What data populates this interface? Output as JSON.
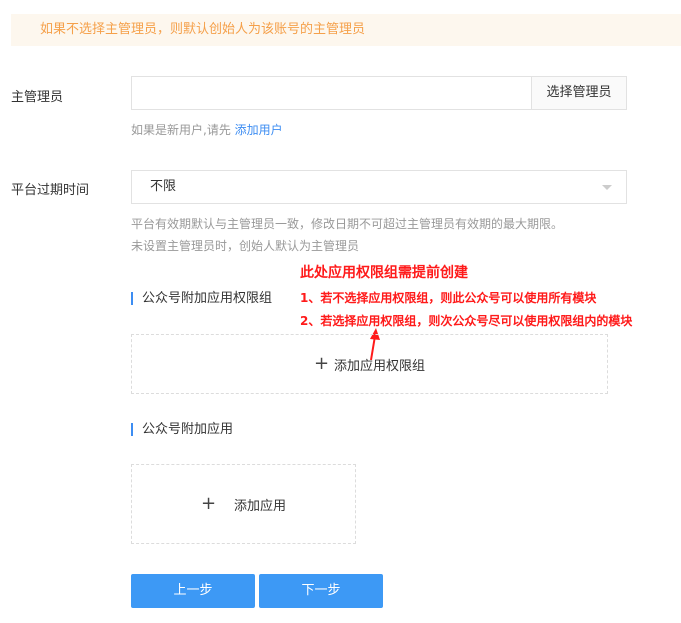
{
  "notice": "如果不选择主管理员，则默认创始人为该账号的主管理员",
  "admin": {
    "label": "主管理员",
    "input_value": "",
    "select_button": "选择管理员",
    "hint_prefix": "如果是新用户,请先",
    "hint_link": "添加用户"
  },
  "expiry": {
    "label": "平台过期时间",
    "value": "不限",
    "hint_line1": "平台有效期默认与主管理员一致，修改日期不可超过主管理员有效期的最大期限。",
    "hint_line2": "未设置主管理员时，创始人默认为主管理员"
  },
  "permission_group": {
    "section_title": "公众号附加应用权限组",
    "add_label": "添加应用权限组"
  },
  "apps": {
    "section_title": "公众号附加应用",
    "add_label": "添加应用"
  },
  "annotation": {
    "title": "此处应用权限组需提前创建",
    "line1": "1、若不选择应用权限组，则此公众号可以使用所有模块",
    "line2": "2、若选择应用权限组，则次公众号尽可以使用权限组内的模块",
    "color": "#ff1a1a"
  },
  "buttons": {
    "prev": "上一步",
    "next": "下一步"
  },
  "colors": {
    "primary": "#3d99f5",
    "link": "#3d8df2",
    "notice_text": "#f5a04a",
    "notice_bg": "#fdf7ee"
  }
}
